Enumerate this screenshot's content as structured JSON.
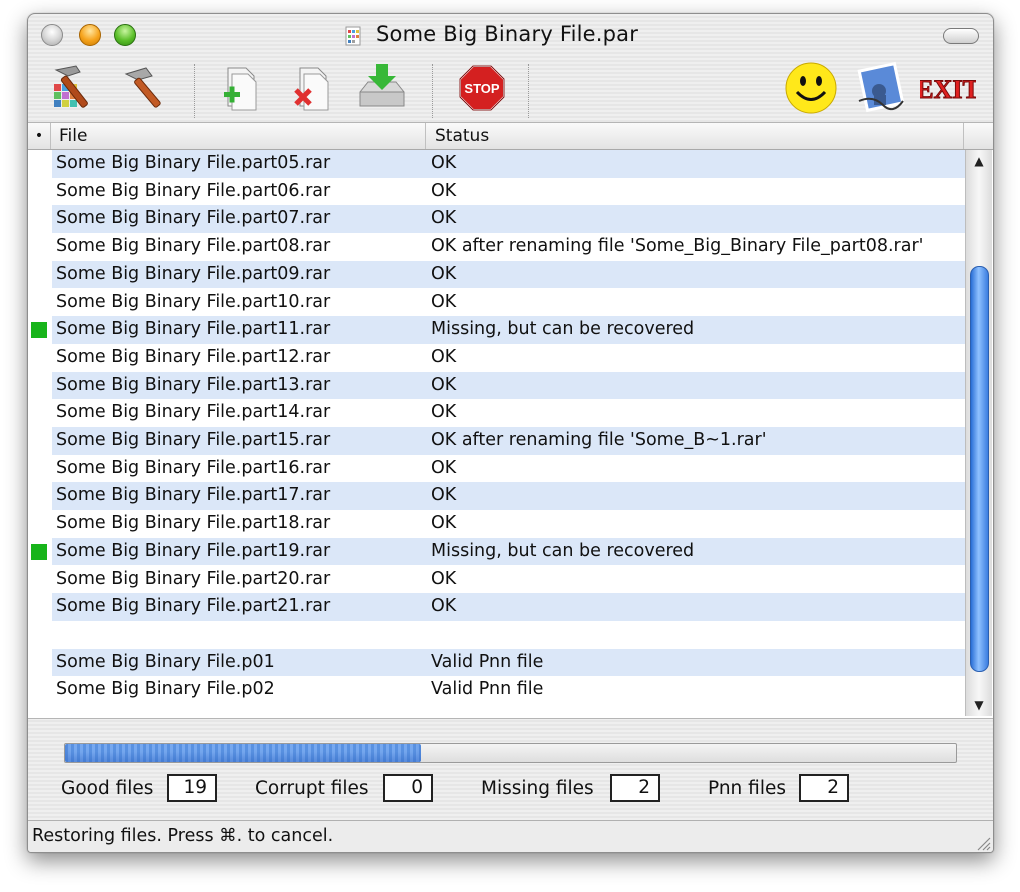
{
  "window": {
    "title": "Some Big Binary File.par"
  },
  "toolbar": {
    "buttons": [
      {
        "icon": "wrench-hammer-colors-icon"
      },
      {
        "icon": "hammer-icon"
      },
      {
        "icon": "add-file-icon"
      },
      {
        "icon": "remove-file-icon"
      },
      {
        "icon": "download-disk-icon"
      },
      {
        "icon": "stop-icon",
        "label": "STOP"
      },
      {
        "icon": "smiley-icon"
      },
      {
        "icon": "mail-stamp-icon"
      },
      {
        "icon": "exit-icon",
        "label": "EXIT"
      }
    ]
  },
  "table": {
    "columns": {
      "marker": "•",
      "file": "File",
      "status": "Status"
    },
    "rows": [
      {
        "file": "Some Big Binary File.part05.rar",
        "status": "OK",
        "marked": false
      },
      {
        "file": "Some Big Binary File.part06.rar",
        "status": "OK",
        "marked": false
      },
      {
        "file": "Some Big Binary File.part07.rar",
        "status": "OK",
        "marked": false
      },
      {
        "file": "Some Big Binary File.part08.rar",
        "status": "OK after renaming file 'Some_Big_Binary File_part08.rar'",
        "marked": false
      },
      {
        "file": "Some Big Binary File.part09.rar",
        "status": "OK",
        "marked": false
      },
      {
        "file": "Some Big Binary File.part10.rar",
        "status": "OK",
        "marked": false
      },
      {
        "file": "Some Big Binary File.part11.rar",
        "status": "Missing, but can be recovered",
        "marked": true
      },
      {
        "file": "Some Big Binary File.part12.rar",
        "status": "OK",
        "marked": false
      },
      {
        "file": "Some Big Binary File.part13.rar",
        "status": "OK",
        "marked": false
      },
      {
        "file": "Some Big Binary File.part14.rar",
        "status": "OK",
        "marked": false
      },
      {
        "file": "Some Big Binary File.part15.rar",
        "status": "OK after renaming file 'Some_B~1.rar'",
        "marked": false
      },
      {
        "file": "Some Big Binary File.part16.rar",
        "status": "OK",
        "marked": false
      },
      {
        "file": "Some Big Binary File.part17.rar",
        "status": "OK",
        "marked": false
      },
      {
        "file": "Some Big Binary File.part18.rar",
        "status": "OK",
        "marked": false
      },
      {
        "file": "Some Big Binary File.part19.rar",
        "status": "Missing, but can be recovered",
        "marked": true
      },
      {
        "file": "Some Big Binary File.part20.rar",
        "status": "OK",
        "marked": false
      },
      {
        "file": "Some Big Binary File.part21.rar",
        "status": "OK",
        "marked": false
      },
      {
        "file": "",
        "status": "",
        "marked": false
      },
      {
        "file": "Some Big Binary File.p01",
        "status": "Valid Pnn file",
        "marked": false
      },
      {
        "file": "Some Big Binary File.p02",
        "status": "Valid Pnn file",
        "marked": false
      }
    ],
    "marker_color": "#17b41a",
    "alt_row_color": "#dbe7f8"
  },
  "progress": {
    "fraction": 0.4
  },
  "counts": {
    "good": {
      "label": "Good files",
      "value": "19"
    },
    "corrupt": {
      "label": "Corrupt files",
      "value": "0"
    },
    "missing": {
      "label": "Missing files",
      "value": "2"
    },
    "pnn": {
      "label": "Pnn files",
      "value": "2"
    }
  },
  "status_bar": {
    "text": "Restoring files. Press ⌘. to cancel."
  }
}
